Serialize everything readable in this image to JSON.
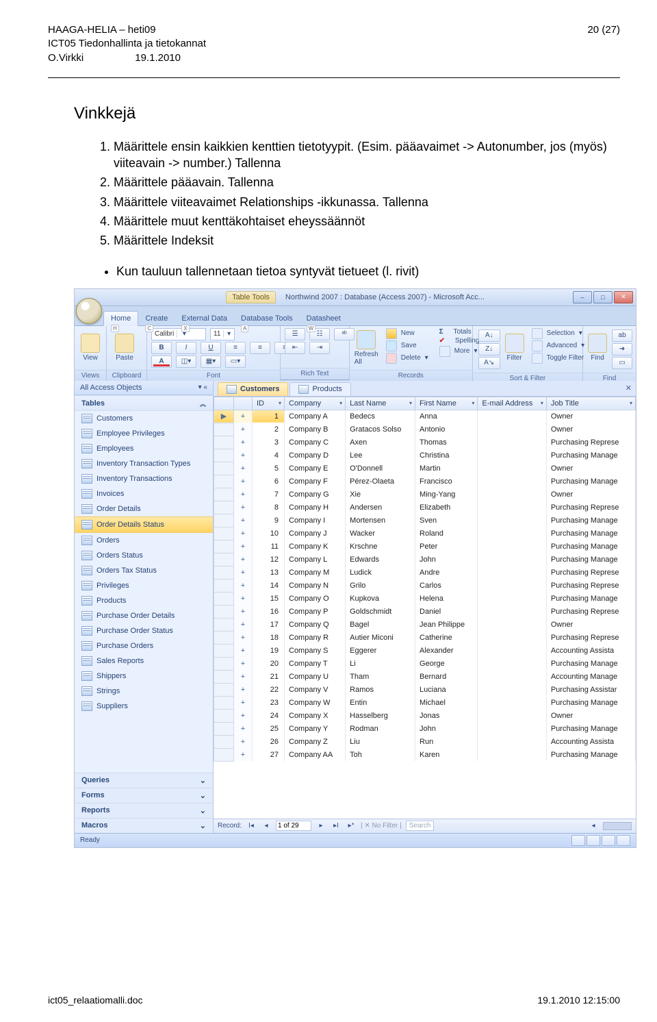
{
  "header": {
    "l1": "HAAGA-HELIA – heti09",
    "l2": "ICT05 Tiedonhallinta ja tietokannat",
    "l3": "O.Virkki",
    "date": "19.1.2010",
    "page": "20 (27)"
  },
  "content": {
    "title": "Vinkkejä",
    "steps": [
      "Määrittele ensin kaikkien kenttien tietotyypit. (Esim. pääavaimet -> Autonumber, jos (myös) viiteavain -> number.) Tallenna",
      "Määrittele pääavain. Tallenna",
      "Määrittele viiteavaimet Relationships -ikkunassa. Tallenna",
      "Määrittele muut kenttäkohtaiset eheyssäännöt",
      "Määrittele Indeksit"
    ],
    "bullet": "Kun tauluun tallennetaan tietoa syntyvät tietueet (l. rivit)"
  },
  "sshot": {
    "titlebar": {
      "tool": "Table Tools",
      "title": "Northwind 2007 : Database (Access 2007) - Microsoft Acc..."
    },
    "tabs": [
      {
        "label": "Home",
        "key": "H",
        "active": true
      },
      {
        "label": "Create",
        "key": "C"
      },
      {
        "label": "External Data",
        "key": "X"
      },
      {
        "label": "Database Tools",
        "key": "A"
      },
      {
        "label": "Datasheet",
        "key": "W"
      }
    ],
    "ribbon": {
      "views": {
        "name": "Views",
        "btn": "View"
      },
      "clipboard": {
        "name": "Clipboard",
        "btn": "Paste"
      },
      "font": {
        "name": "Font",
        "family": "Calibri",
        "size": "11"
      },
      "richtext": {
        "name": "Rich Text"
      },
      "records": {
        "name": "Records",
        "refresh": "Refresh All",
        "new": "New",
        "save": "Save",
        "delete": "Delete",
        "totals": "Totals",
        "spelling": "Spelling",
        "more": "More"
      },
      "sortfilter": {
        "name": "Sort & Filter",
        "filter": "Filter",
        "sel": "Selection",
        "adv": "Advanced",
        "tog": "Toggle Filter"
      },
      "find": {
        "name": "Find",
        "find": "Find"
      }
    },
    "nav": {
      "head": "All Access Objects",
      "cat": "Tables",
      "items": [
        "Customers",
        "Employee Privileges",
        "Employees",
        "Inventory Transaction Types",
        "Inventory Transactions",
        "Invoices",
        "Order Details",
        "Order Details Status",
        "Orders",
        "Orders Status",
        "Orders Tax Status",
        "Privileges",
        "Products",
        "Purchase Order Details",
        "Purchase Order Status",
        "Purchase Orders",
        "Sales Reports",
        "Shippers",
        "Strings",
        "Suppliers"
      ],
      "selIndex": 7,
      "groups": [
        "Queries",
        "Forms",
        "Reports",
        "Macros"
      ]
    },
    "ds": {
      "tabs": [
        {
          "label": "Customers",
          "active": true
        },
        {
          "label": "Products",
          "active": false
        }
      ],
      "cols": [
        "ID",
        "Company",
        "Last Name",
        "First Name",
        "E-mail Address",
        "Job Title"
      ],
      "rows": [
        {
          "id": 1,
          "c": "Company A",
          "l": "Bedecs",
          "f": "Anna",
          "e": "",
          "j": "Owner",
          "sel": true
        },
        {
          "id": 2,
          "c": "Company B",
          "l": "Gratacos Solso",
          "f": "Antonio",
          "e": "",
          "j": "Owner"
        },
        {
          "id": 3,
          "c": "Company C",
          "l": "Axen",
          "f": "Thomas",
          "e": "",
          "j": "Purchasing Represe"
        },
        {
          "id": 4,
          "c": "Company D",
          "l": "Lee",
          "f": "Christina",
          "e": "",
          "j": "Purchasing Manage"
        },
        {
          "id": 5,
          "c": "Company E",
          "l": "O'Donnell",
          "f": "Martin",
          "e": "",
          "j": "Owner"
        },
        {
          "id": 6,
          "c": "Company F",
          "l": "Pérez-Olaeta",
          "f": "Francisco",
          "e": "",
          "j": "Purchasing Manage"
        },
        {
          "id": 7,
          "c": "Company G",
          "l": "Xie",
          "f": "Ming-Yang",
          "e": "",
          "j": "Owner"
        },
        {
          "id": 8,
          "c": "Company H",
          "l": "Andersen",
          "f": "Elizabeth",
          "e": "",
          "j": "Purchasing Represe"
        },
        {
          "id": 9,
          "c": "Company I",
          "l": "Mortensen",
          "f": "Sven",
          "e": "",
          "j": "Purchasing Manage"
        },
        {
          "id": 10,
          "c": "Company J",
          "l": "Wacker",
          "f": "Roland",
          "e": "",
          "j": "Purchasing Manage"
        },
        {
          "id": 11,
          "c": "Company K",
          "l": "Krschne",
          "f": "Peter",
          "e": "",
          "j": "Purchasing Manage"
        },
        {
          "id": 12,
          "c": "Company L",
          "l": "Edwards",
          "f": "John",
          "e": "",
          "j": "Purchasing Manage"
        },
        {
          "id": 13,
          "c": "Company M",
          "l": "Ludick",
          "f": "Andre",
          "e": "",
          "j": "Purchasing Represe"
        },
        {
          "id": 14,
          "c": "Company N",
          "l": "Grilo",
          "f": "Carlos",
          "e": "",
          "j": "Purchasing Represe"
        },
        {
          "id": 15,
          "c": "Company O",
          "l": "Kupkova",
          "f": "Helena",
          "e": "",
          "j": "Purchasing Manage"
        },
        {
          "id": 16,
          "c": "Company P",
          "l": "Goldschmidt",
          "f": "Daniel",
          "e": "",
          "j": "Purchasing Represe"
        },
        {
          "id": 17,
          "c": "Company Q",
          "l": "Bagel",
          "f": "Jean Philippe",
          "e": "",
          "j": "Owner"
        },
        {
          "id": 18,
          "c": "Company R",
          "l": "Autier Miconi",
          "f": "Catherine",
          "e": "",
          "j": "Purchasing Represe"
        },
        {
          "id": 19,
          "c": "Company S",
          "l": "Eggerer",
          "f": "Alexander",
          "e": "",
          "j": "Accounting Assista"
        },
        {
          "id": 20,
          "c": "Company T",
          "l": "Li",
          "f": "George",
          "e": "",
          "j": "Purchasing Manage"
        },
        {
          "id": 21,
          "c": "Company U",
          "l": "Tham",
          "f": "Bernard",
          "e": "",
          "j": "Accounting Manage"
        },
        {
          "id": 22,
          "c": "Company V",
          "l": "Ramos",
          "f": "Luciana",
          "e": "",
          "j": "Purchasing Assistar"
        },
        {
          "id": 23,
          "c": "Company W",
          "l": "Entin",
          "f": "Michael",
          "e": "",
          "j": "Purchasing Manage"
        },
        {
          "id": 24,
          "c": "Company X",
          "l": "Hasselberg",
          "f": "Jonas",
          "e": "",
          "j": "Owner"
        },
        {
          "id": 25,
          "c": "Company Y",
          "l": "Rodman",
          "f": "John",
          "e": "",
          "j": "Purchasing Manage"
        },
        {
          "id": 26,
          "c": "Company Z",
          "l": "Liu",
          "f": "Run",
          "e": "",
          "j": "Accounting Assista"
        },
        {
          "id": 27,
          "c": "Company AA",
          "l": "Toh",
          "f": "Karen",
          "e": "",
          "j": "Purchasing Manage"
        }
      ],
      "recnav": {
        "label": "Record:",
        "pos": "1 of 29",
        "nofilter": "No Filter",
        "search": "Search"
      },
      "status": "Ready"
    }
  },
  "footer": {
    "left": "ict05_relaatiomalli.doc",
    "right": "19.1.2010 12:15:00"
  }
}
